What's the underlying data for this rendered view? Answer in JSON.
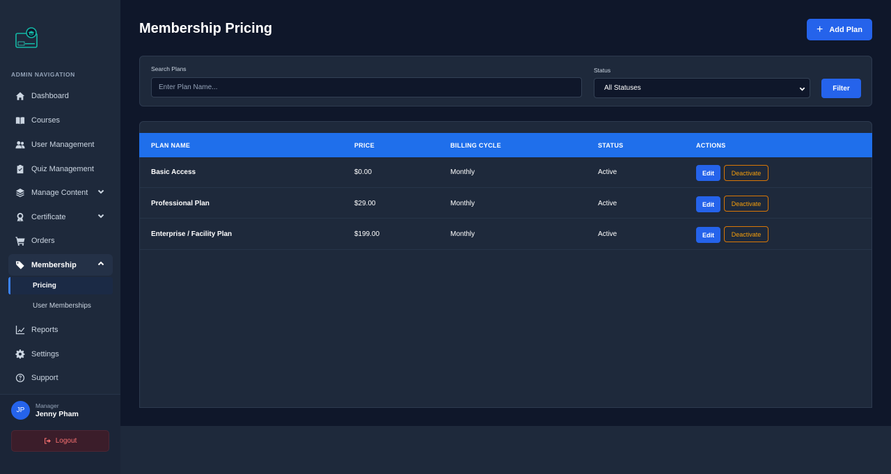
{
  "sidebar": {
    "heading": "ADMIN NAVIGATION",
    "items": [
      {
        "label": "Dashboard",
        "icon": "home-icon"
      },
      {
        "label": "Courses",
        "icon": "book-icon"
      },
      {
        "label": "User Management",
        "icon": "users-icon"
      },
      {
        "label": "Quiz Management",
        "icon": "clipboard-check-icon"
      },
      {
        "label": "Manage Content",
        "icon": "layers-icon",
        "expandable": true
      },
      {
        "label": "Certificate",
        "icon": "award-icon",
        "expandable": true
      },
      {
        "label": "Orders",
        "icon": "cart-icon"
      },
      {
        "label": "Membership",
        "icon": "tags-icon",
        "expandable": true,
        "expanded": true
      },
      {
        "label": "Reports",
        "icon": "chart-line-icon"
      },
      {
        "label": "Settings",
        "icon": "gear-icon"
      },
      {
        "label": "Support",
        "icon": "question-circle-icon"
      }
    ],
    "sub_items": [
      {
        "label": "Pricing",
        "active": true
      },
      {
        "label": "User Memberships",
        "active": false
      }
    ]
  },
  "user": {
    "initials": "JP",
    "role": "Manager",
    "name": "Jenny Pham",
    "logout_label": "Logout"
  },
  "page": {
    "title": "Membership Pricing",
    "add_label": "Add Plan"
  },
  "filters": {
    "search_label": "Search Plans",
    "search_placeholder": "Enter Plan Name...",
    "status_label": "Status",
    "status_value": "All Statuses",
    "filter_label": "Filter"
  },
  "table": {
    "headers": [
      "PLAN NAME",
      "PRICE",
      "BILLING CYCLE",
      "STATUS",
      "ACTIONS"
    ],
    "rows": [
      {
        "name": "Basic Access",
        "price": "$0.00",
        "cycle": "Monthly",
        "status": "Active",
        "edit": "Edit",
        "deactivate": "Deactivate"
      },
      {
        "name": "Professional Plan",
        "price": "$29.00",
        "cycle": "Monthly",
        "status": "Active",
        "edit": "Edit",
        "deactivate": "Deactivate"
      },
      {
        "name": "Enterprise / Facility Plan",
        "price": "$199.00",
        "cycle": "Monthly",
        "status": "Active",
        "edit": "Edit",
        "deactivate": "Deactivate"
      }
    ]
  },
  "colors": {
    "accent": "#2563eb",
    "header_blue": "#1f6feb",
    "warning": "#f59e0b",
    "danger": "#f87171"
  }
}
